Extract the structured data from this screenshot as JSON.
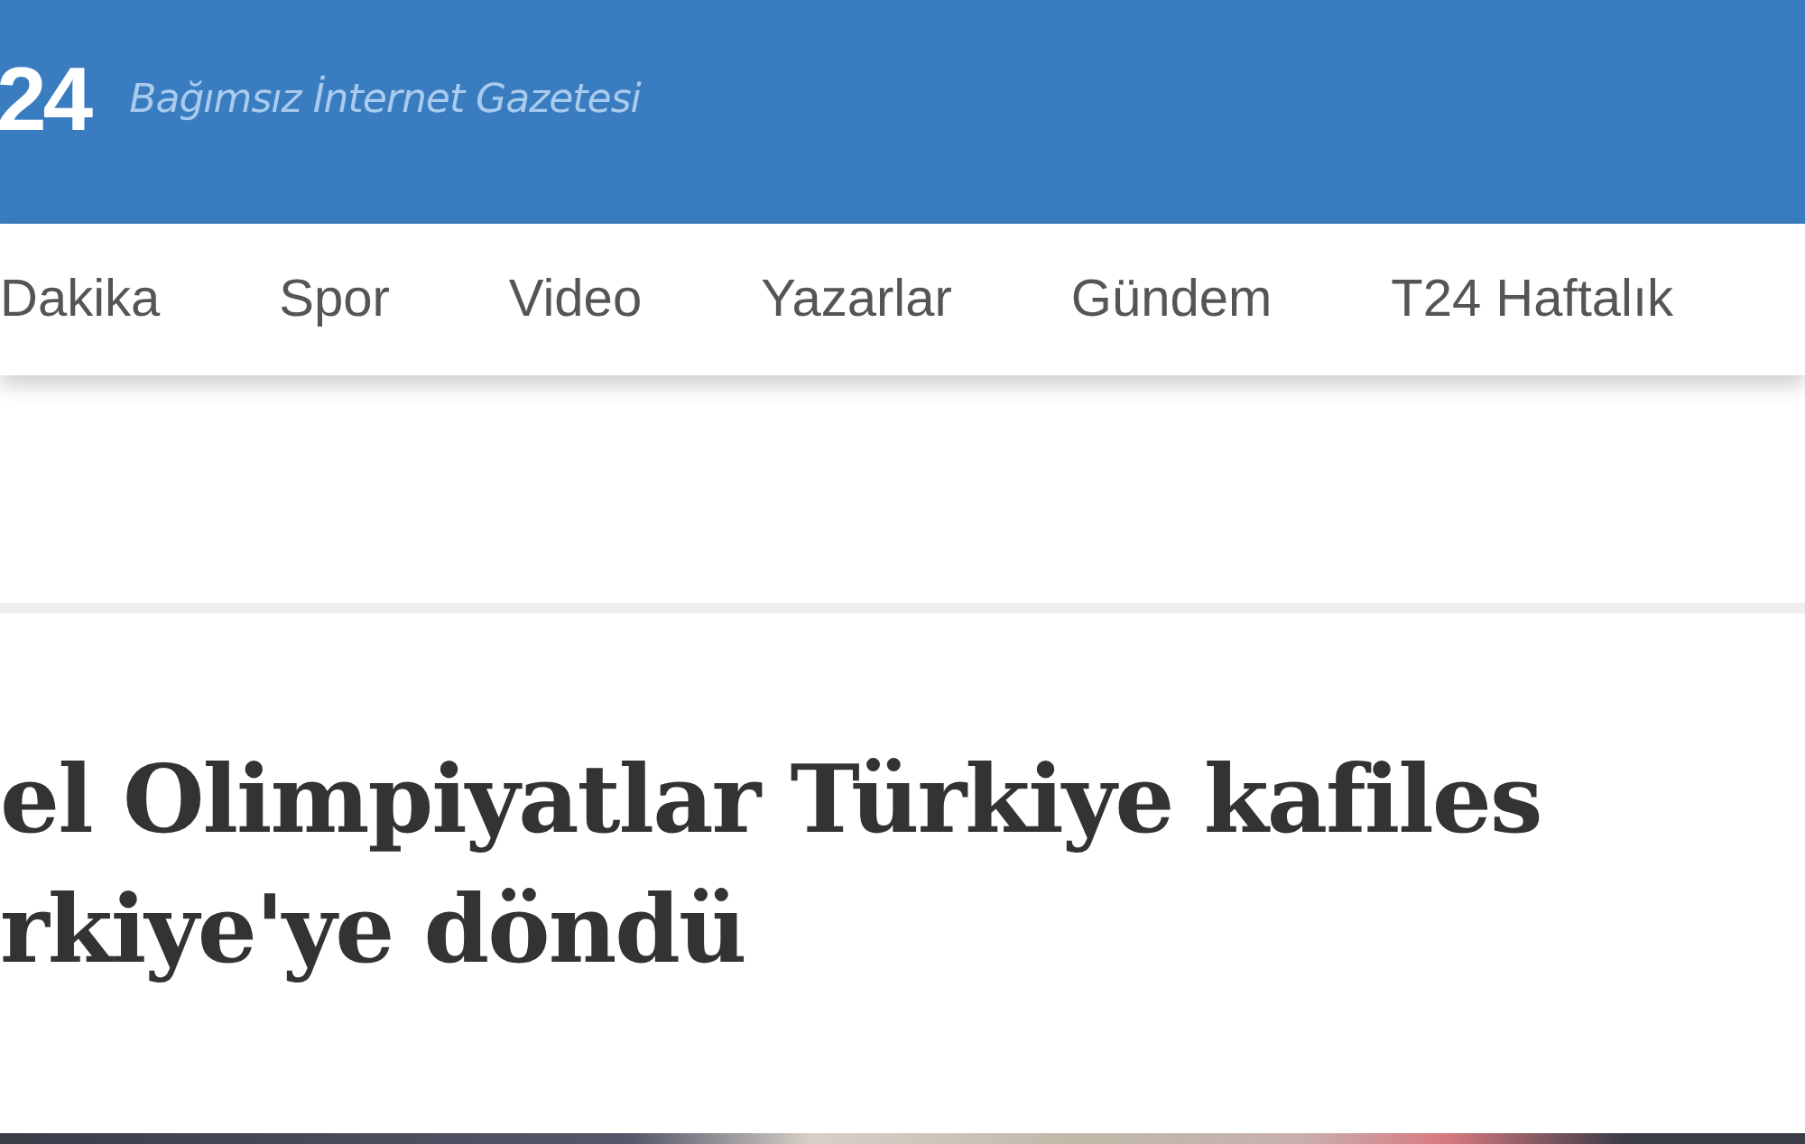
{
  "header": {
    "logo": "24",
    "tagline": "Bağımsız İnternet Gazetesi"
  },
  "nav": {
    "items": [
      {
        "label": "Dakika"
      },
      {
        "label": "Spor"
      },
      {
        "label": "Video"
      },
      {
        "label": "Yazarlar"
      },
      {
        "label": "Gündem"
      },
      {
        "label": "T24 Haftalık"
      }
    ]
  },
  "article": {
    "headline_lines": [
      "el Olimpiyatlar Türkiye kafiles",
      "rkiye'ye döndü"
    ]
  }
}
